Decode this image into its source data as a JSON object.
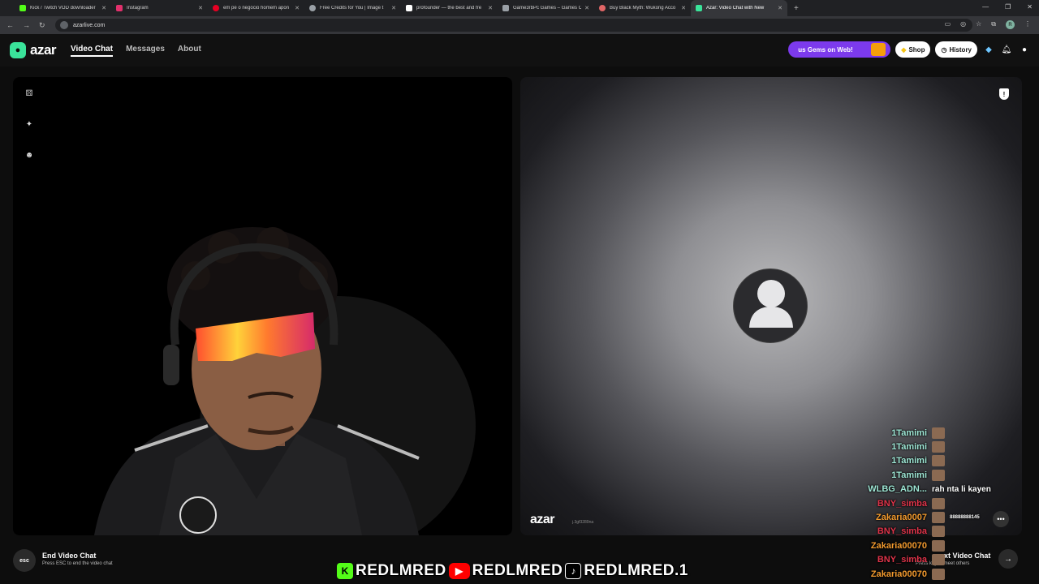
{
  "browser": {
    "tabs": [
      {
        "title": "Kick / Twitch VOD downloader",
        "color": "#53fc18",
        "glyph": "D"
      },
      {
        "title": "Instagram",
        "color": "#e1306c",
        "glyph": ""
      },
      {
        "title": "em pé o negócio homem apon",
        "color": "#e60023",
        "glyph": ""
      },
      {
        "title": "Free Credits for You | Image t",
        "color": "#9aa0a6",
        "glyph": ""
      },
      {
        "title": "profounder — the best and fre",
        "color": "#ffffff",
        "glyph": "P"
      },
      {
        "title": "Game3rbPc Games – Games Or",
        "color": "#9aa0a6",
        "glyph": ""
      },
      {
        "title": "Buy Black Myth: Wukong Acco",
        "color": "#e06666",
        "glyph": ""
      },
      {
        "title": "Azar: Video Chat with New",
        "color": "#3ae39a",
        "glyph": ""
      }
    ],
    "url": "azarlive.com",
    "profile_initial": "R"
  },
  "app": {
    "logo_text": "azar",
    "nav": [
      "Video Chat",
      "Messages",
      "About"
    ],
    "gems_label": "us Gems on Web!",
    "shop_label": "Shop",
    "history_label": "History"
  },
  "remote": {
    "watermark": "azar",
    "watermark_id": "j.3gf3289na"
  },
  "footer": {
    "esc_key": "esc",
    "end_title": "End Video Chat",
    "end_sub": "Press ESC to end the video chat",
    "next_title": "ext Video Chat",
    "next_sub": "Press  key to meet others"
  },
  "chat": [
    {
      "user": "1Tamimi",
      "color": "#9fe8d6",
      "msg": ""
    },
    {
      "user": "1Tamimi",
      "color": "#9fe8d6",
      "msg": ""
    },
    {
      "user": "1Tamimi",
      "color": "#9fe8d6",
      "msg": ""
    },
    {
      "user": "1Tamimi",
      "color": "#9fe8d6",
      "msg": ""
    },
    {
      "user": "WLBG_ADN...",
      "color": "#9fe8d6",
      "msg": "rah nta li kayen"
    },
    {
      "user": "BNY_simba",
      "color": "#e0344a",
      "msg": ""
    },
    {
      "user": "Zakaria0007",
      "color": "#f29a2e",
      "msg": "88888888145"
    },
    {
      "user": "BNY_simba",
      "color": "#e0344a",
      "msg": ""
    },
    {
      "user": "Zakaria00070",
      "color": "#f29a2e",
      "msg": ""
    },
    {
      "user": "BNY_simba",
      "color": "#e0344a",
      "msg": ""
    },
    {
      "user": "Zakaria00070",
      "color": "#f29a2e",
      "msg": ""
    }
  ],
  "banner": {
    "handles": [
      "REDLMRED",
      "REDLMRED",
      "REDLMRED.1"
    ],
    "platforms": [
      "kick-icon",
      "youtube-icon",
      "tiktok-icon"
    ]
  }
}
